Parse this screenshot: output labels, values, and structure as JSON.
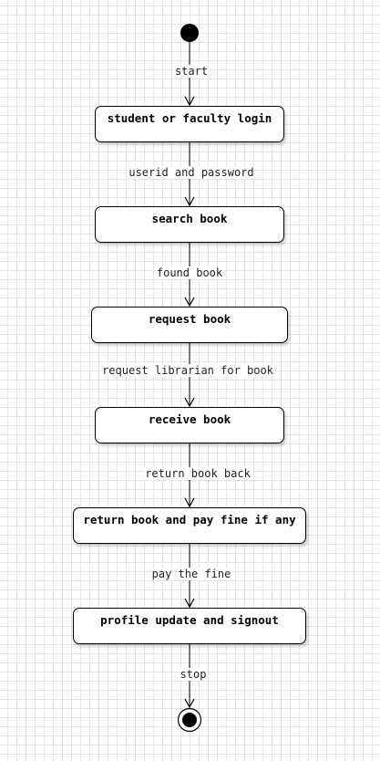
{
  "activities": [
    "student or faculty login",
    "search book",
    "request book",
    "receive book",
    "return book and pay fine if any",
    "profile update and signout"
  ],
  "transitions": [
    "start",
    "userid and password",
    "found book",
    "request librarian for book",
    "return book back",
    "pay the fine",
    "stop"
  ]
}
